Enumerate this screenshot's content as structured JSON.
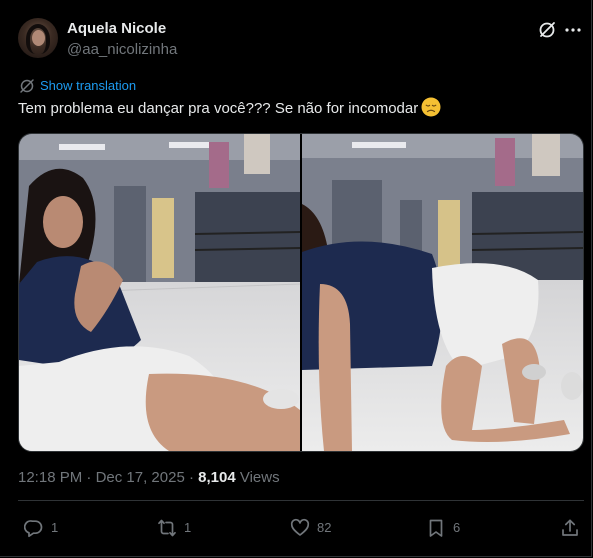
{
  "author": {
    "name": "Aquela Nicole",
    "handle": "@aa_nicolizinha"
  },
  "translate": {
    "label": "Show translation"
  },
  "tweet": {
    "text": "Tem problema eu dançar pra você??? Se não for incomodar",
    "emoji": "disappointed-face-emoji"
  },
  "media": {
    "count": 2
  },
  "meta": {
    "time": "12:18 PM",
    "separator1": " · ",
    "date": "Dec 17, 2025",
    "separator2": " · ",
    "views_count": "8,104",
    "views_label": " Views"
  },
  "actions": {
    "replies": "1",
    "reposts": "1",
    "likes": "82",
    "bookmarks": "6"
  },
  "colors": {
    "background": "#000000",
    "primary_text": "#e7e9ea",
    "secondary_text": "#71767b",
    "link": "#1d9bf0",
    "border": "#2f3336"
  }
}
